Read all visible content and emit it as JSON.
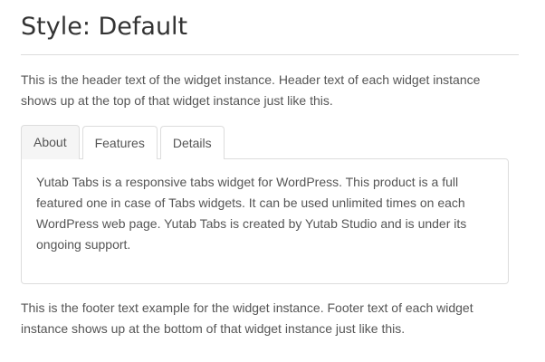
{
  "widget": {
    "title": "Style: Default",
    "header_text": "This is the header text of the widget instance. Header text of each widget instance shows up at the top of that widget instance just like this.",
    "tabs": [
      {
        "label": "About",
        "active": true
      },
      {
        "label": "Features",
        "active": false
      },
      {
        "label": "Details",
        "active": false
      }
    ],
    "panel_text": "Yutab Tabs is a responsive tabs widget for WordPress. This product is a full featured one in case of Tabs widgets. It can be used unlimited times on each WordPress web page. Yutab Tabs is created by Yutab Studio and is under its ongoing support.",
    "footer_text": "This is the footer text example for the widget instance. Footer text of each widget instance shows up at the bottom of that widget instance just like this."
  },
  "colors": {
    "text": "#555555",
    "title": "#333333",
    "border": "#dddddd",
    "active_tab_bg": "#f5f5f5"
  }
}
